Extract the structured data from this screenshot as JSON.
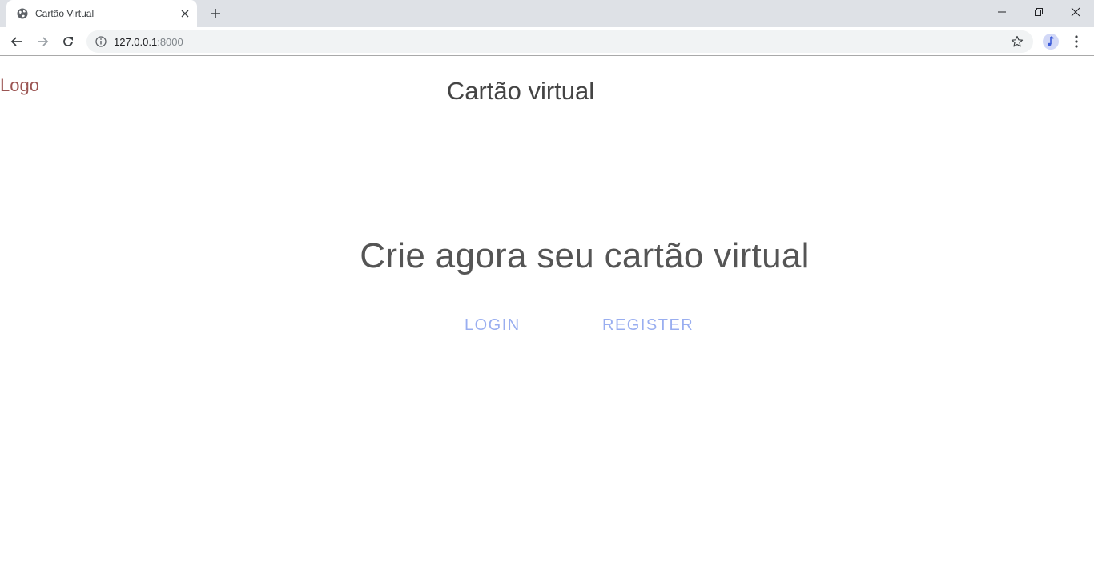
{
  "browser": {
    "tab_title": "Cartão Virtual",
    "url_host": "127.0.0.1",
    "url_port": ":8000"
  },
  "page": {
    "logo": "Logo",
    "title": "Cartão virtual",
    "hero": "Crie agora seu cartão virtual",
    "links": {
      "login": "LOGIN",
      "register": "REGISTER"
    }
  },
  "colors": {
    "logo": "#9b5553",
    "links": "#99aef0",
    "text": "#444444"
  }
}
